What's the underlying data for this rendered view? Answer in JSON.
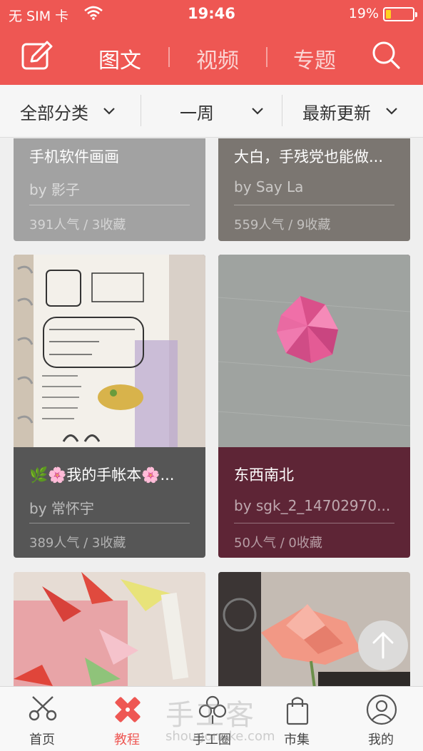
{
  "status": {
    "carrier": "无 SIM 卡",
    "time": "19:46",
    "battery": "19%",
    "battery_level": 0.19,
    "battery_color": "#ffd21f"
  },
  "header": {
    "edit_icon": "edit-icon",
    "search_icon": "search-icon",
    "tabs": [
      "图文",
      "视频",
      "专题"
    ],
    "active_tab": 0,
    "bg_color": "#ee5753"
  },
  "filters": [
    {
      "label": "全部分类",
      "icon": "chevron-down-icon"
    },
    {
      "label": "一周",
      "icon": "chevron-down-icon"
    },
    {
      "label": "最新更新",
      "icon": "chevron-down-icon"
    }
  ],
  "cards": [
    {
      "title": "手机软件画画",
      "author": "by 影子",
      "stats": "391人气 / 3收藏",
      "color": "#a2a2a2"
    },
    {
      "title": "大白，手残党也能做...",
      "author": "by Say La",
      "stats": "559人气 / 9收藏",
      "color": "#7b7671"
    },
    {
      "title": "🌿🌸我的手帐本🌸...",
      "author": "by 常怀宇",
      "stats": "389人气 / 3收藏",
      "color": "#565656"
    },
    {
      "title": "东西南北",
      "author": "by sgk_2_14702970...",
      "stats": "50人气 / 0收藏",
      "color": "#5e2536"
    },
    {
      "title": "",
      "author": "",
      "stats": "",
      "color": "#d2c9c5"
    },
    {
      "title": "",
      "author": "",
      "stats": "",
      "color": "#e9e4e0"
    }
  ],
  "tabbar": [
    {
      "label": "首页",
      "icon": "scissors-icon"
    },
    {
      "label": "教程",
      "icon": "pencil-ruler-icon"
    },
    {
      "label": "手工圈",
      "icon": "flower-icon"
    },
    {
      "label": "市集",
      "icon": "shopping-bag-icon"
    },
    {
      "label": "我的",
      "icon": "user-icon"
    }
  ],
  "active_tabbar": 1,
  "watermark": {
    "text": "手工客",
    "url": "shougongke.com"
  },
  "scroll_top_icon": "arrow-up-icon"
}
